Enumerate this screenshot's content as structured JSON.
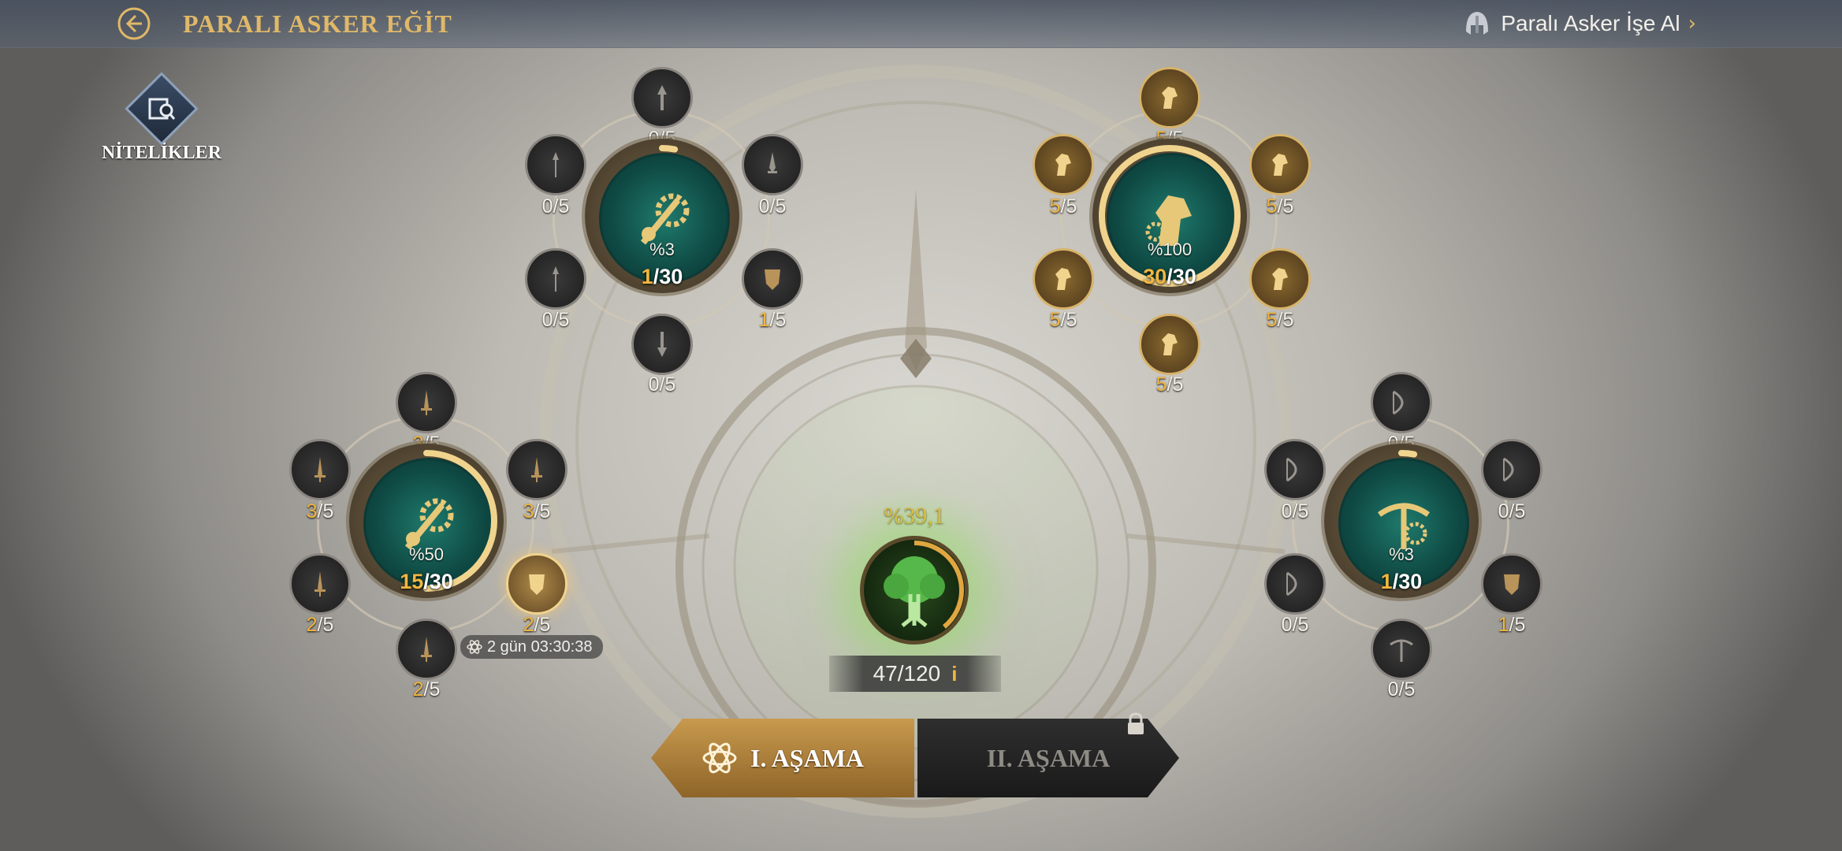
{
  "header": {
    "title": "PARALI ASKER EĞİT",
    "hire_label": "Paralı Asker İşe Al",
    "hire_chevron": "›"
  },
  "qualities": {
    "label": "NİTELİKLER"
  },
  "clusters": [
    {
      "id": "top-left",
      "percent": "%3",
      "level_current": "1",
      "level_sep_max": "/30",
      "progress": 0.03,
      "nodes": [
        {
          "cur": "0",
          "max": "/5"
        },
        {
          "cur": "0",
          "max": "/5"
        },
        {
          "cur": "0",
          "max": "/5"
        },
        {
          "cur": "0",
          "max": "/5"
        },
        {
          "cur": "1",
          "max": "/5"
        },
        {
          "cur": "0",
          "max": "/5"
        }
      ]
    },
    {
      "id": "top-right",
      "percent": "%100",
      "level_current": "30",
      "level_sep_max": "/30",
      "progress": 1.0,
      "nodes": [
        {
          "cur": "5",
          "max": "/5"
        },
        {
          "cur": "5",
          "max": "/5"
        },
        {
          "cur": "5",
          "max": "/5"
        },
        {
          "cur": "5",
          "max": "/5"
        },
        {
          "cur": "5",
          "max": "/5"
        },
        {
          "cur": "5",
          "max": "/5"
        }
      ]
    },
    {
      "id": "bottom-left",
      "percent": "%50",
      "level_current": "15",
      "level_sep_max": "/30",
      "progress": 0.5,
      "nodes": [
        {
          "cur": "3",
          "max": "/5"
        },
        {
          "cur": "3",
          "max": "/5"
        },
        {
          "cur": "3",
          "max": "/5"
        },
        {
          "cur": "2",
          "max": "/5"
        },
        {
          "cur": "2",
          "max": "/5"
        },
        {
          "cur": "2",
          "max": "/5"
        }
      ]
    },
    {
      "id": "bottom-right",
      "percent": "%3",
      "level_current": "1",
      "level_sep_max": "/30",
      "progress": 0.03,
      "nodes": [
        {
          "cur": "0",
          "max": "/5"
        },
        {
          "cur": "0",
          "max": "/5"
        },
        {
          "cur": "0",
          "max": "/5"
        },
        {
          "cur": "0",
          "max": "/5"
        },
        {
          "cur": "1",
          "max": "/5"
        },
        {
          "cur": "0",
          "max": "/5"
        }
      ]
    }
  ],
  "timer": {
    "text": "2 gün 03:30:38"
  },
  "tree": {
    "percent": "%39,1",
    "count": "47/120",
    "info": "i",
    "progress": 0.391
  },
  "stages": [
    {
      "label": "I. AŞAMA",
      "active": true
    },
    {
      "label": "II. AŞAMA",
      "active": false,
      "locked": true
    }
  ],
  "colors": {
    "gold": "#f1b640",
    "title_gold": "#e0b868",
    "teal": "#1f7a6c"
  }
}
